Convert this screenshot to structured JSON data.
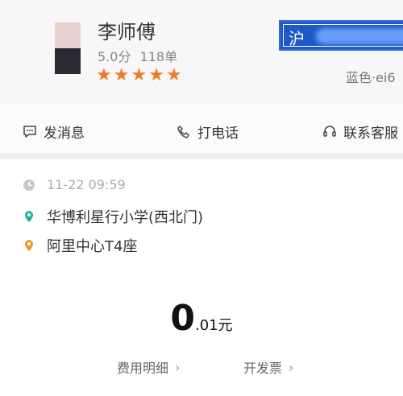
{
  "driver": {
    "name": "李师傅",
    "rating": "5.0分",
    "orders": "118单",
    "star_count": 5,
    "plate_prefix": "沪",
    "car_description": "蓝色·ei6"
  },
  "actions": {
    "message": "发消息",
    "call": "打电话",
    "support": "联系客服"
  },
  "trip": {
    "time": "11-22 09:59",
    "from": "华博利星行小学(西北门)",
    "to": "阿里中心T4座"
  },
  "fare": {
    "integer": "0",
    "fraction": ".01元"
  },
  "links": {
    "details": "费用明细",
    "invoice": "开发票"
  },
  "colors": {
    "accent": "#f07a2a",
    "plate_blue": "#1f59c7",
    "origin_dot": "#1bb59b",
    "dest_dot": "#f0962a"
  }
}
